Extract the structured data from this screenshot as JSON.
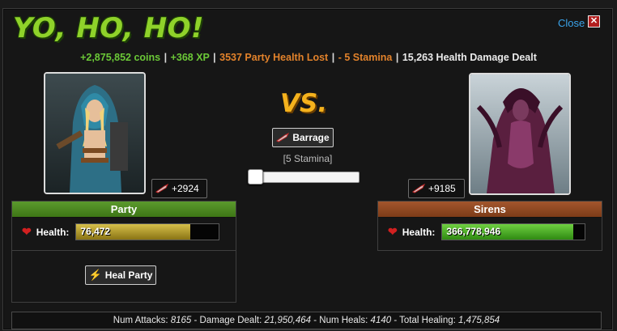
{
  "dialog": {
    "title": "YO, HO, HO!",
    "close_label": "Close",
    "close_icon": "x"
  },
  "rewards": {
    "coins": "+2,875,852 coins",
    "xp": "+368 XP",
    "health_lost": "3537 Party Health Lost",
    "stamina": "- 5 Stamina",
    "damage": "15,263 Health Damage Dealt",
    "separator": "|"
  },
  "party": {
    "name": "Party",
    "damage_bonus": "+2924",
    "health_label": "Health:",
    "health_value": "76,472",
    "health_fraction": 0.8,
    "heal_button": "Heal Party"
  },
  "enemy": {
    "name": "Sirens",
    "damage_bonus": "+9185",
    "health_label": "Health:",
    "health_value": "366,778,946",
    "health_fraction": 0.92
  },
  "battle": {
    "vs": "VS.",
    "attack_button": "Barrage",
    "stamina_cost": "[5 Stamina]",
    "slider_value": 0
  },
  "stats": {
    "attacks_label": "Num Attacks:",
    "attacks_value": "8165",
    "damage_label": "- Damage Dealt:",
    "damage_value": "21,950,464",
    "heals_label": "- Num Heals:",
    "heals_value": "4140",
    "healing_label": "- Total Healing:",
    "healing_value": "1,475,854"
  },
  "colors": {
    "title": "#8fd22a",
    "coins_xp": "#6bc837",
    "loss": "#e2822b",
    "link": "#3aa3ea",
    "party_header": "#4b8420",
    "enemy_header": "#8d4520"
  }
}
